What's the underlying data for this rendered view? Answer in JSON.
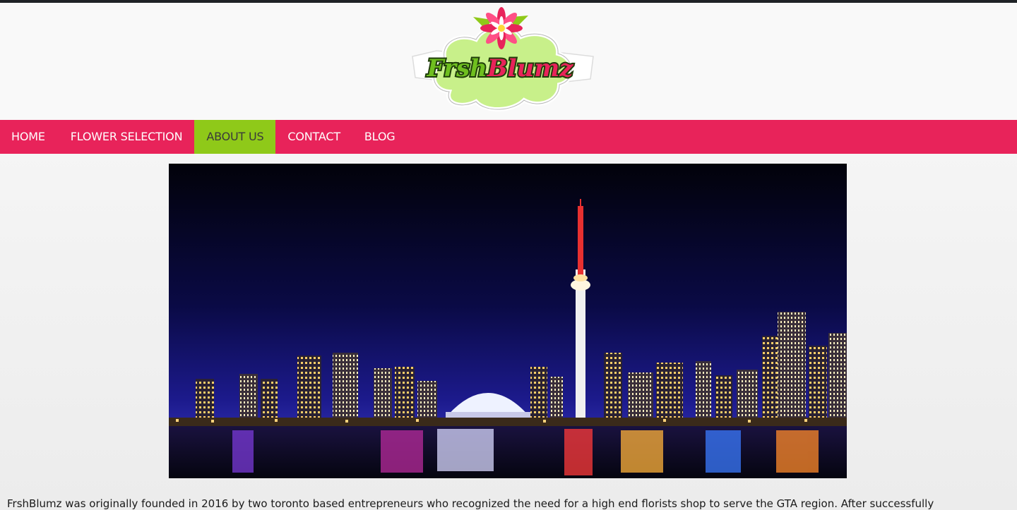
{
  "brand": {
    "logo_text": "FrshBlumz",
    "colors": {
      "primary": "#e8235a",
      "active": "#8fc919",
      "logo_cloud": "#c8f08a",
      "logo_text_green": "#6fbf1f",
      "logo_text_pink": "#e8235a"
    }
  },
  "nav": {
    "items": [
      {
        "label": "HOME",
        "active": false
      },
      {
        "label": "FLOWER SELECTION",
        "active": false
      },
      {
        "label": "ABOUT US",
        "active": true
      },
      {
        "label": "CONTACT",
        "active": false
      },
      {
        "label": "BLOG",
        "active": false
      }
    ]
  },
  "hero": {
    "image": "toronto-skyline-night"
  },
  "about": {
    "text": "FrshBlumz was originally founded in 2016 by two toronto based entrepreneurs who recognized the need for a high end florists shop to serve the GTA region. After successfully"
  }
}
